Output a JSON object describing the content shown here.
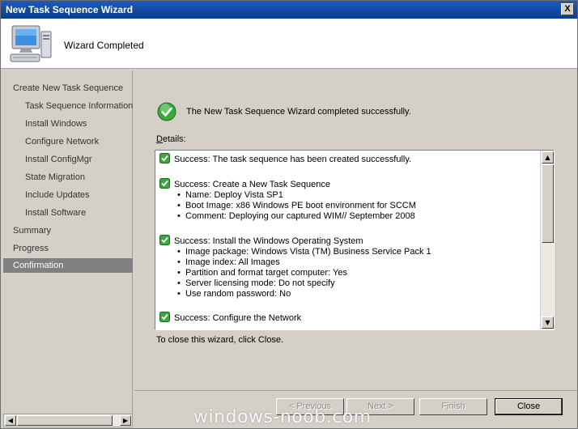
{
  "window": {
    "title": "New Task Sequence Wizard",
    "close_glyph": "X"
  },
  "header": {
    "title": "Wizard Completed",
    "icon": "computer-icon"
  },
  "sidebar": {
    "items": [
      {
        "label": "Create New Task Sequence",
        "level": 0
      },
      {
        "label": "Task Sequence Information",
        "level": 1
      },
      {
        "label": "Install Windows",
        "level": 1
      },
      {
        "label": "Configure Network",
        "level": 1
      },
      {
        "label": "Install ConfigMgr",
        "level": 1
      },
      {
        "label": "State Migration",
        "level": 1
      },
      {
        "label": "Include Updates",
        "level": 1
      },
      {
        "label": "Install Software",
        "level": 1
      },
      {
        "label": "Summary",
        "level": 0
      },
      {
        "label": "Progress",
        "level": 0
      },
      {
        "label": "Confirmation",
        "level": 0,
        "active": true
      }
    ]
  },
  "content": {
    "success_message": "The New Task Sequence Wizard completed successfully.",
    "details_label_key": "D",
    "details_label_rest": "etails:",
    "close_hint": "To close this wizard, click Close.",
    "details": [
      {
        "title": "Success: The task sequence has been created successfully.",
        "items": []
      },
      {
        "title": "Success: Create a New Task Sequence",
        "items": [
          "Name: Deploy Vista SP1",
          "Boot Image: x86 Windows PE boot environment for SCCM",
          "Comment: Deploying our captured WIM// September 2008"
        ]
      },
      {
        "title": "Success: Install the Windows Operating System",
        "items": [
          "Image package: Windows Vista (TM) Business Service Pack 1",
          "Image index: All Images",
          "Partition and format target computer: Yes",
          "Server licensing mode: Do not specify",
          "Use random password: No"
        ]
      },
      {
        "title": "Success: Configure the Network",
        "items": []
      }
    ]
  },
  "buttons": {
    "previous": "< Previous",
    "next": "Next >",
    "finish": "Finish",
    "close": "Close"
  },
  "watermark": "windows-noob.com",
  "colors": {
    "title_bar": "#0a3c8f",
    "active_nav": "#808080",
    "success_green": "#2e9e2e"
  }
}
